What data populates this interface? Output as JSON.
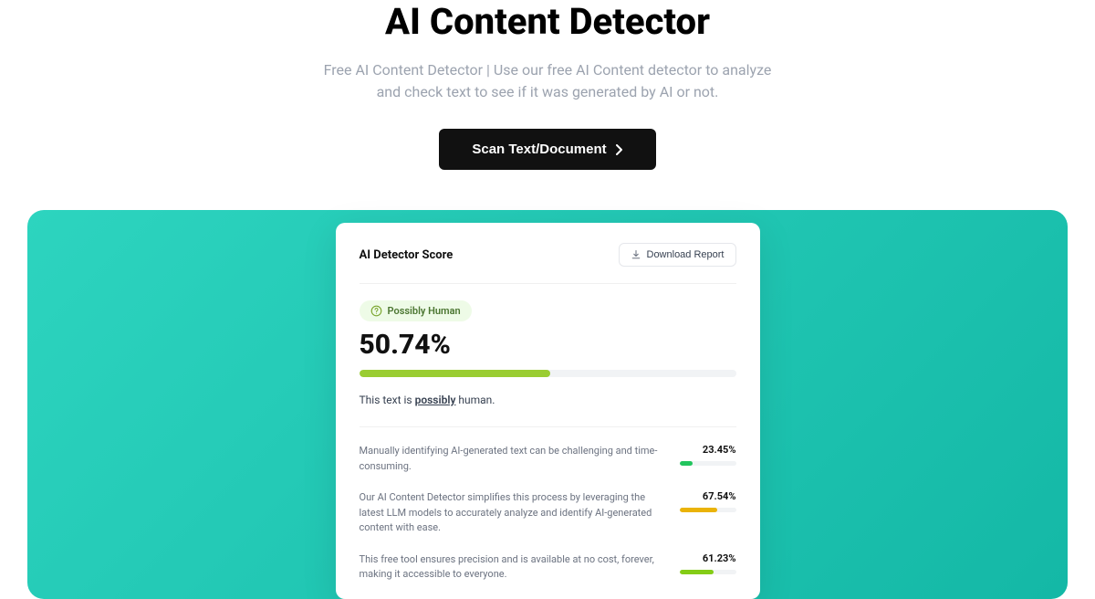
{
  "hero": {
    "title": "AI Content Detector",
    "subtitle": "Free AI Content Detector | Use our free AI Content detector to analyze and check text to see if it was generated by AI or not.",
    "cta_label": "Scan Text/Document"
  },
  "card": {
    "header_label": "AI Detector Score",
    "download_label": "Download Report",
    "badge_text": "Possibly Human",
    "score_display": "50.74%",
    "score_percent": 50.74,
    "result_prefix": "This text is ",
    "result_bold": "possibly",
    "result_suffix": " human.",
    "colors": {
      "main_bar": "#9acd32",
      "badge_bg": "#eefbe7",
      "panel_bg": "#2dd4bf"
    },
    "items": [
      {
        "text": "Manually identifying AI-generated text can be challenging and time-consuming.",
        "pct_display": "23.45%",
        "pct": 23.45,
        "bar_color": "#22c55e"
      },
      {
        "text": "Our AI Content Detector simplifies this process by leveraging the latest LLM models to accurately analyze and identify AI-generated content with ease.",
        "pct_display": "67.54%",
        "pct": 67.54,
        "bar_color": "#eab308"
      },
      {
        "text": "This free tool ensures precision and is available at no cost, forever, making it accessible to everyone.",
        "pct_display": "61.23%",
        "pct": 61.23,
        "bar_color": "#84cc16"
      }
    ]
  }
}
